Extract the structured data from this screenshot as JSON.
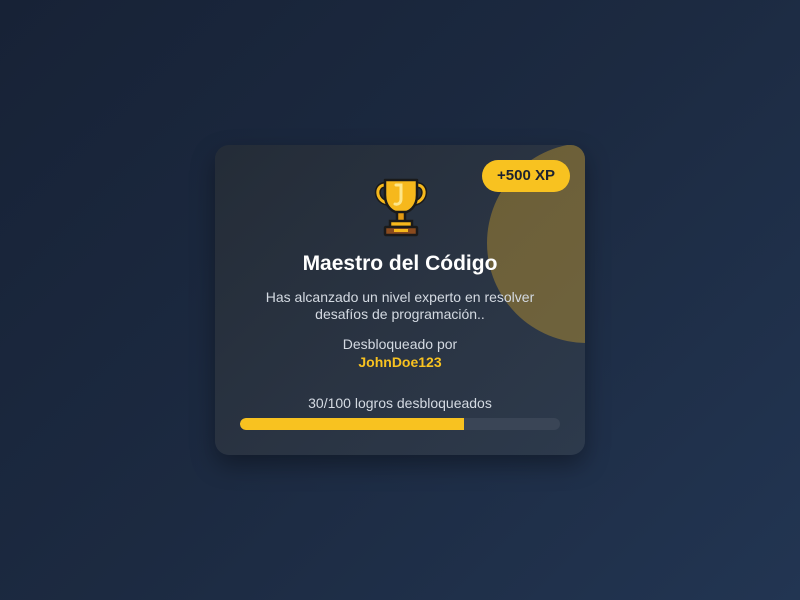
{
  "achievement": {
    "xp_badge": "+500 XP",
    "icon": "trophy-icon",
    "title": "Maestro del Código",
    "description": "Has alcanzado un nivel experto en resolver desafíos de programación..",
    "unlocked_by_label": "Desbloqueado por",
    "username": "JohnDoe123",
    "progress_text": "30/100 logros desbloqueados",
    "progress_fill_fraction": 0.7
  },
  "colors": {
    "accent": "#f8c220",
    "card_background": "#2a3443",
    "page_background": "#1c2a41",
    "progress_track": "#3a4556"
  }
}
